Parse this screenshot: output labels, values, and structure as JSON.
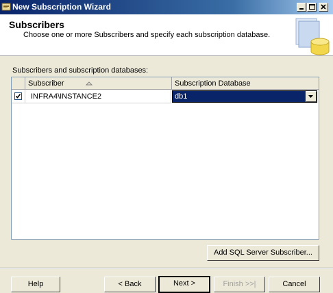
{
  "window": {
    "title": "New Subscription Wizard"
  },
  "header": {
    "title": "Subscribers",
    "subtitle": "Choose one or more Subscribers and specify each subscription database."
  },
  "grid": {
    "label": "Subscribers and subscription databases:",
    "columns": [
      "Subscriber",
      "Subscription Database"
    ],
    "rows": [
      {
        "checked": true,
        "subscriber": "INFRA4\\INSTANCE2",
        "database": "db1"
      }
    ]
  },
  "buttons": {
    "add_subscriber": "Add SQL Server Subscriber...",
    "help": "Help",
    "back": "< Back",
    "next": "Next >",
    "finish": "Finish >>|",
    "cancel": "Cancel"
  },
  "colors": {
    "titlebar": "#0a246a",
    "selection": "#0a246a",
    "face": "#ece9d8"
  }
}
